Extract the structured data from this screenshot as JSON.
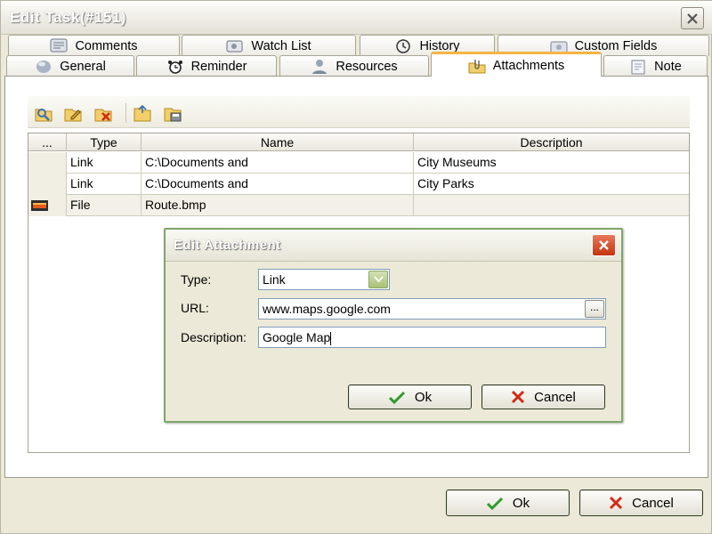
{
  "window": {
    "title": "Edit Task(#151)"
  },
  "tabs": {
    "row_top": [
      {
        "label": "Comments",
        "icon": "comments-icon"
      },
      {
        "label": "Watch List",
        "icon": "watch-list-icon"
      },
      {
        "label": "History",
        "icon": "history-icon"
      },
      {
        "label": "Custom Fields",
        "icon": "custom-fields-icon"
      }
    ],
    "row_bottom": [
      {
        "label": "General",
        "icon": "general-icon"
      },
      {
        "label": "Reminder",
        "icon": "alarm-clock-icon"
      },
      {
        "label": "Resources",
        "icon": "person-icon"
      },
      {
        "label": "Attachments",
        "icon": "paperclip-folder-icon",
        "active": true
      },
      {
        "label": "Note",
        "icon": "note-icon"
      }
    ]
  },
  "grid": {
    "columns": [
      "...",
      "Type",
      "Name",
      "Description"
    ],
    "rows": [
      {
        "type": "Link",
        "name": "C:\\Documents and",
        "description": "City Museums"
      },
      {
        "type": "Link",
        "name": "C:\\Documents and",
        "description": "City Parks"
      },
      {
        "type": "File",
        "name": "Route.bmp",
        "description": ""
      }
    ]
  },
  "dialog": {
    "title": "Edit Attachment",
    "type_label": "Type:",
    "type_value": "Link",
    "url_label": "URL:",
    "url_value": "www.maps.google.com",
    "ellipsis_label": "...",
    "description_label": "Description:",
    "description_value": "Google Map",
    "ok_label": "Ok",
    "cancel_label": "Cancel"
  },
  "footer": {
    "ok_label": "Ok",
    "cancel_label": "Cancel"
  },
  "colors": {
    "active_tab_accent": "#f7b446",
    "dialog_border": "#7da76a",
    "close_red": "#c3360f",
    "ok_check_green": "#2f9a2f"
  }
}
